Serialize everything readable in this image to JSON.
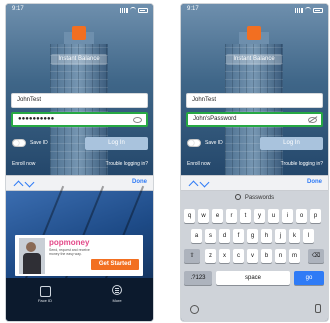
{
  "left": {
    "status_time": "9:17",
    "instant_balance": "Instant Balance",
    "username": "JohnTest",
    "password_masked": "●●●●●●●●●●",
    "save_id": "Save ID",
    "login": "Log In",
    "enroll": "Enroll now",
    "trouble": "Trouble logging in?",
    "done": "Done",
    "ad": {
      "brand": "popmoney",
      "tagline": "Send, request and receive money the easy way.",
      "cta": "Get Started"
    },
    "nav": {
      "faceid": "Face ID",
      "more": "More"
    }
  },
  "right": {
    "status_time": "9:17",
    "instant_balance": "Instant Balance",
    "username": "JohnTest",
    "password_plain": "John'sPassword",
    "save_id": "Save ID",
    "login": "Log In",
    "enroll": "Enroll now",
    "trouble": "Trouble logging in?",
    "done": "Done",
    "quicktype": "Passwords",
    "keyboard": {
      "row1": [
        "q",
        "w",
        "e",
        "r",
        "t",
        "y",
        "u",
        "i",
        "o",
        "p"
      ],
      "row2": [
        "a",
        "s",
        "d",
        "f",
        "g",
        "h",
        "j",
        "k",
        "l"
      ],
      "row3": [
        "z",
        "x",
        "c",
        "v",
        "b",
        "n",
        "m"
      ],
      "numbers": ".?123",
      "space": "space",
      "go": "go"
    }
  },
  "colors": {
    "accent": "#f26f21",
    "focus_border": "#27a844",
    "link_blue": "#2f7bf6",
    "login_button": "#a9c3dd"
  },
  "icons": [
    "shift-icon",
    "backspace-icon",
    "emoji-icon",
    "microphone-icon",
    "face-id-icon",
    "more-icon",
    "eye-icon",
    "eye-slash-icon"
  ]
}
